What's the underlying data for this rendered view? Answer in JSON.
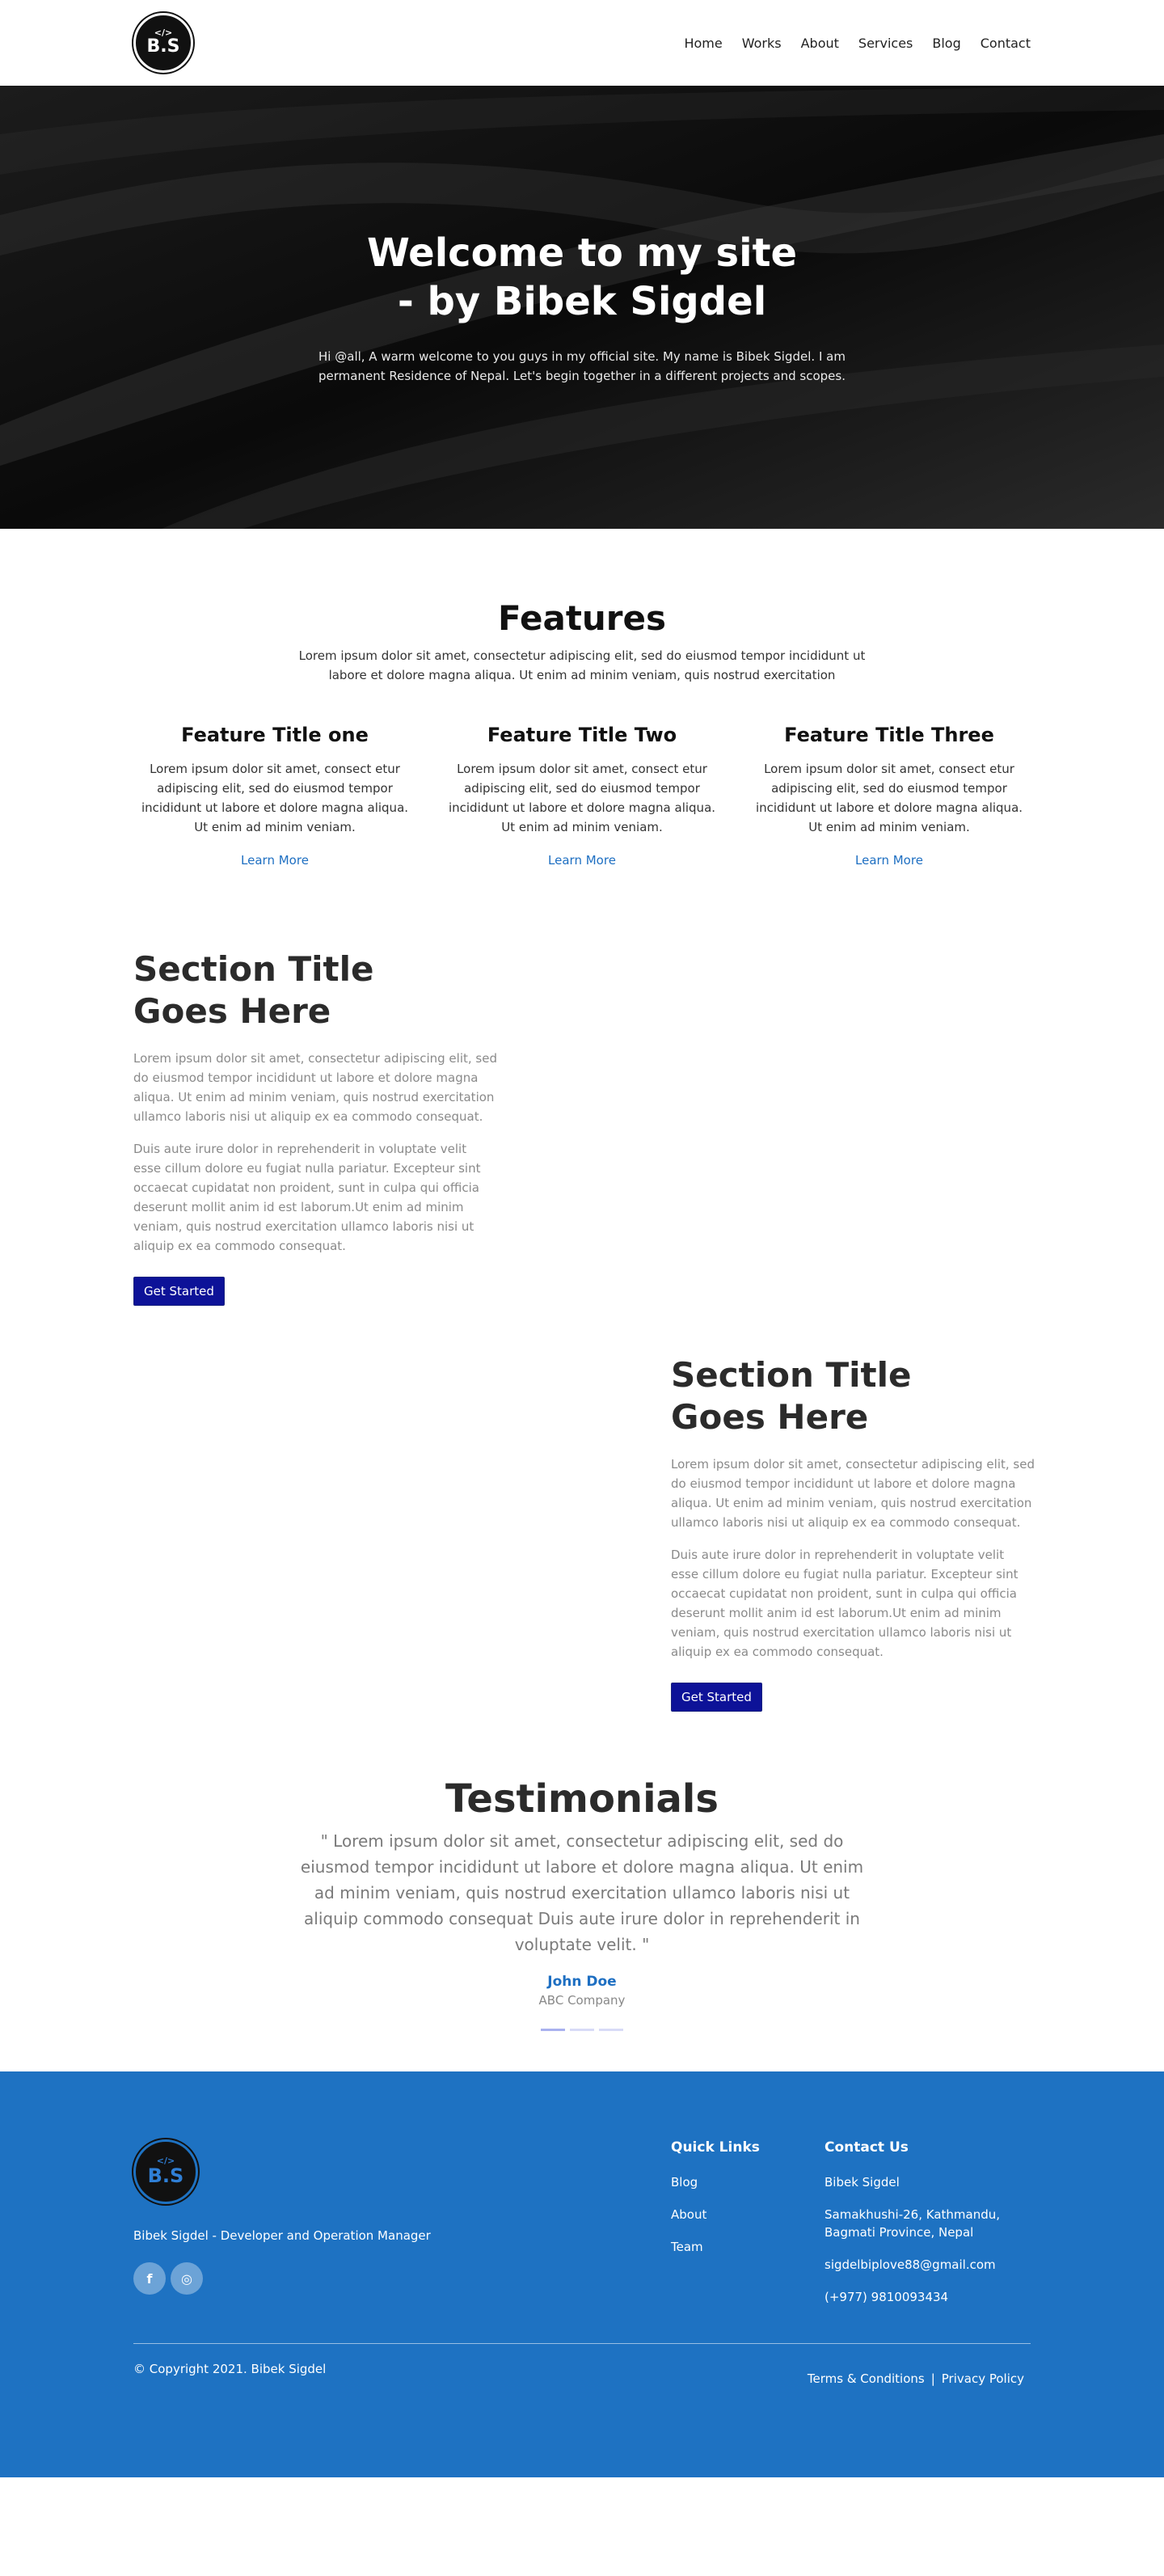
{
  "brand": {
    "logo_code": "</>",
    "logo_text": "B.S"
  },
  "nav": [
    "Home",
    "Works",
    "About",
    "Services",
    "Blog",
    "Contact"
  ],
  "hero": {
    "title_line1": "Welcome to my site",
    "title_line2": "- by Bibek Sigdel",
    "text": "Hi @all, A warm welcome to you guys in my official site. My name is Bibek Sigdel. I am permanent Residence of Nepal. Let's begin together in a different projects and scopes."
  },
  "features": {
    "title": "Features",
    "subtitle": "Lorem ipsum dolor sit amet, consectetur adipiscing elit, sed do eiusmod tempor incididunt ut labore et dolore magna aliqua. Ut enim ad minim veniam, quis nostrud exercitation",
    "items": [
      {
        "title": "Feature Title one",
        "text": "Lorem ipsum dolor sit amet, consect etur adipiscing elit, sed do eiusmod tempor incididunt ut labore et dolore magna aliqua. Ut enim ad minim veniam.",
        "link": "Learn More"
      },
      {
        "title": "Feature Title Two",
        "text": "Lorem ipsum dolor sit amet, consect etur adipiscing elit, sed do eiusmod tempor incididunt ut labore et dolore magna aliqua. Ut enim ad minim veniam.",
        "link": "Learn More"
      },
      {
        "title": "Feature Title Three",
        "text": "Lorem ipsum dolor sit amet, consect etur adipiscing elit, sed do eiusmod tempor incididunt ut labore et dolore magna aliqua. Ut enim ad minim veniam.",
        "link": "Learn More"
      }
    ]
  },
  "sections": [
    {
      "title_line1": "Section Title",
      "title_line2": "Goes Here",
      "p1": "Lorem ipsum dolor sit amet, consectetur adipiscing elit, sed do eiusmod tempor incididunt ut labore et dolore magna aliqua. Ut enim ad minim veniam, quis nostrud exercitation ullamco laboris nisi ut aliquip ex ea commodo consequat.",
      "p2": "Duis aute irure dolor in reprehenderit in voluptate velit esse cillum dolore eu fugiat nulla pariatur. Excepteur sint occaecat cupidatat non proident, sunt in culpa qui officia deserunt mollit anim id est laborum.Ut enim ad minim veniam, quis nostrud exercitation ullamco laboris nisi ut aliquip ex ea commodo consequat.",
      "button": "Get Started"
    },
    {
      "title_line1": "Section Title",
      "title_line2": "Goes Here",
      "p1": "Lorem ipsum dolor sit amet, consectetur adipiscing elit, sed do eiusmod tempor incididunt ut labore et dolore magna aliqua. Ut enim ad minim veniam, quis nostrud exercitation ullamco laboris nisi ut aliquip ex ea commodo consequat.",
      "p2": "Duis aute irure dolor in reprehenderit in voluptate velit esse cillum dolore eu fugiat nulla pariatur. Excepteur sint occaecat cupidatat non proident, sunt in culpa qui officia deserunt mollit anim id est laborum.Ut enim ad minim veniam, quis nostrud exercitation ullamco laboris nisi ut aliquip ex ea commodo consequat.",
      "button": "Get Started"
    }
  ],
  "testimonials": {
    "title": "Testimonials",
    "quote": "\" Lorem ipsum dolor sit amet, consectetur adipiscing elit, sed do eiusmod tempor incididunt ut labore et dolore magna aliqua. Ut enim ad minim veniam, quis nostrud exercitation ullamco laboris nisi ut aliquip commodo consequat Duis aute irure dolor in reprehenderit in voluptate velit. \"",
    "name": "John Doe",
    "company": "ABC Company",
    "slide_count": 3,
    "active_slide": 1
  },
  "footer": {
    "tagline": "Bibek Sigdel - Developer and Operation Manager",
    "socials": [
      {
        "icon": "facebook-icon",
        "glyph": "f"
      },
      {
        "icon": "instagram-icon",
        "glyph": "◎"
      }
    ],
    "quick_links_title": "Quick Links",
    "quick_links": [
      "Blog",
      "About",
      "Team"
    ],
    "contact_title": "Contact Us",
    "contact_name": "Bibek Sigdel",
    "contact_address": "Samakhushi-26, Kathmandu, Bagmati Province, Nepal",
    "contact_email": "sigdelbiplove88@gmail.com",
    "contact_phone": "(+977) 9810093434",
    "copyright": "© Copyright 2021. Bibek Sigdel",
    "terms": "Terms & Conditions",
    "separator": "|",
    "privacy": "Privacy Policy"
  },
  "colors": {
    "accent": "#1e72c2",
    "button": "#0d1298",
    "link": "#1e6fc2"
  }
}
